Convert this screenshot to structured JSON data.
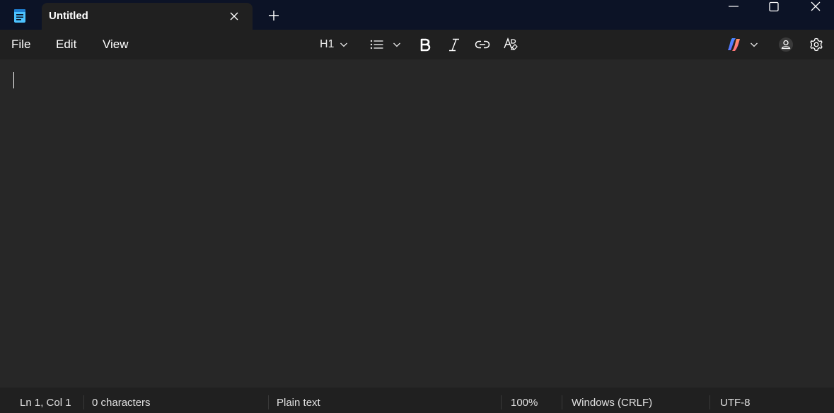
{
  "window": {
    "tab_title": "Untitled",
    "icons": {
      "app": "notepad-icon",
      "tab_close": "close-icon",
      "new_tab": "plus-icon",
      "minimize": "minimize-icon",
      "maximize": "maximize-icon",
      "close": "close-icon"
    }
  },
  "menu": {
    "file": "File",
    "edit": "Edit",
    "view": "View"
  },
  "toolbar": {
    "heading_label": "H1",
    "icons": [
      "chevron-down-icon",
      "list-icon",
      "bold-icon",
      "italic-icon",
      "link-icon",
      "clear-format-icon",
      "copilot-icon",
      "account-icon",
      "gear-icon"
    ]
  },
  "editor": {
    "content": ""
  },
  "status": {
    "position": "Ln 1, Col 1",
    "characters": "0 characters",
    "format": "Plain text",
    "zoom": "100%",
    "line_ending": "Windows (CRLF)",
    "encoding": "UTF-8"
  },
  "colors": {
    "titlebar": "#0c1326",
    "menubar": "#202020",
    "editor": "#272727",
    "text": "#ffffff"
  }
}
